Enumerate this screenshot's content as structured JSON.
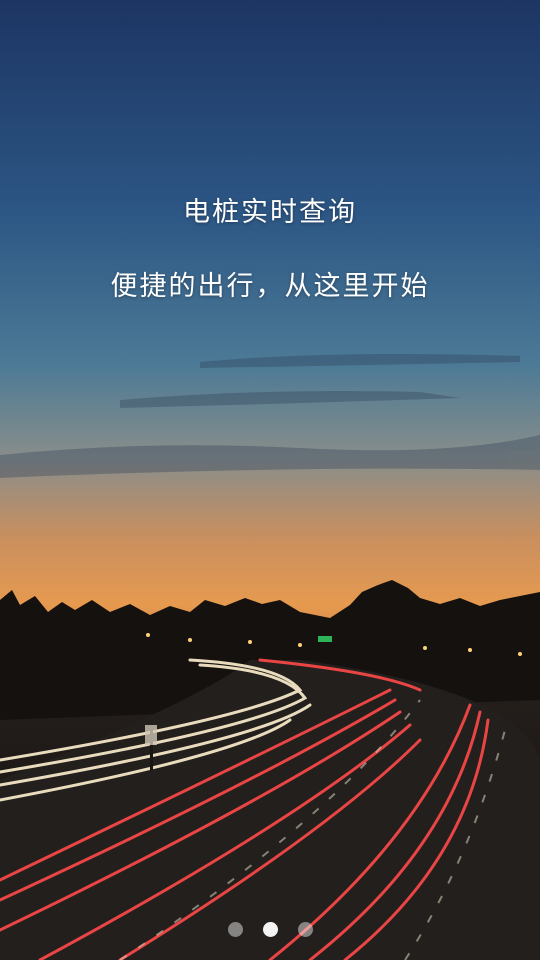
{
  "splash": {
    "title": "电桩实时查询",
    "subtitle": "便捷的出行，从这里开始"
  },
  "pager": {
    "total": 3,
    "active_index": 1
  },
  "colors": {
    "sky_top": "#1e3a66",
    "sky_mid": "#3f6a8f",
    "horizon": "#e59a4c",
    "trail_red": "#ff4a4a",
    "trail_white": "#fff1d0"
  }
}
